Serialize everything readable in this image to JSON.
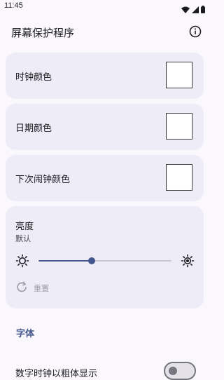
{
  "status_bar": {
    "time": "11:45",
    "icons": [
      "wifi-icon",
      "signal-icon",
      "battery-icon"
    ]
  },
  "app_bar": {
    "title": "屏幕保护程序",
    "info_icon": "info-icon"
  },
  "color_settings": [
    {
      "label": "时钟颜色",
      "swatch_color": "#ffffff"
    },
    {
      "label": "日期颜色",
      "swatch_color": "#ffffff"
    },
    {
      "label": "下次闹钟颜色",
      "swatch_color": "#ffffff"
    }
  ],
  "brightness": {
    "title": "亮度",
    "subtitle": "默认",
    "slider_value_fraction": 0.4,
    "reset_label": "重置"
  },
  "font_section": {
    "header": "字体",
    "bold_digital_clock_label": "数字时钟以粗体显示",
    "bold_toggle_on": false
  },
  "colors": {
    "accent": "#44568f",
    "card_background": "#eeedf7",
    "page_background": "#fbf8fd"
  }
}
